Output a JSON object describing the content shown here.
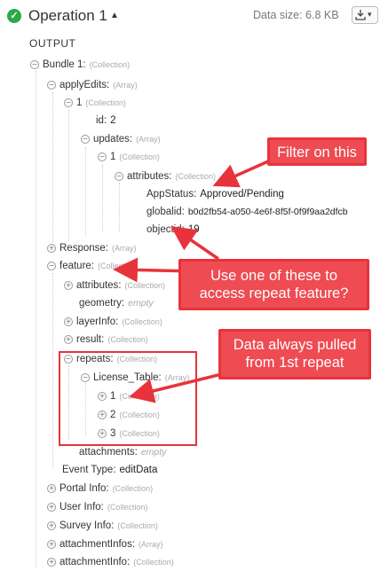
{
  "header": {
    "title": "Operation 1",
    "data_size": "Data size: 6.8 KB",
    "output_label": "OUTPUT"
  },
  "tree": {
    "bundle": {
      "key": "Bundle 1:",
      "type": "(Collection)"
    },
    "applyEdits": {
      "key": "applyEdits:",
      "type": "(Array)"
    },
    "ae_1": {
      "key": "1",
      "type": "(Collection)"
    },
    "id": {
      "key": "id:",
      "value": "2"
    },
    "updates": {
      "key": "updates:",
      "type": "(Array)"
    },
    "up_1": {
      "key": "1",
      "type": "(Collection)"
    },
    "attributes": {
      "key": "attributes:",
      "type": "(Collection)"
    },
    "appstatus": {
      "key": "AppStatus:",
      "value": "Approved/Pending"
    },
    "globalid": {
      "key": "globalid:",
      "value": "b0d2fb54-a050-4e6f-8f5f-0f9f9aa2dfcb"
    },
    "objectid": {
      "key": "objectid:",
      "value": "19"
    },
    "response": {
      "key": "Response:",
      "type": "(Array)"
    },
    "feature": {
      "key": "feature:",
      "type": "(Collection)"
    },
    "f_attributes": {
      "key": "attributes:",
      "type": "(Collection)"
    },
    "geometry": {
      "key": "geometry:",
      "value": "empty"
    },
    "layerinfo": {
      "key": "layerInfo:",
      "type": "(Collection)"
    },
    "result": {
      "key": "result:",
      "type": "(Collection)"
    },
    "repeats": {
      "key": "repeats:",
      "type": "(Collection)"
    },
    "license_table": {
      "key": "License_Table:",
      "type": "(Array)"
    },
    "lt_1": {
      "key": "1",
      "type": "(Collection)"
    },
    "lt_2": {
      "key": "2",
      "type": "(Collection)"
    },
    "lt_3": {
      "key": "3",
      "type": "(Collection)"
    },
    "attachments": {
      "key": "attachments:",
      "value": "empty"
    },
    "event_type": {
      "key": "Event Type:",
      "value": "editData"
    },
    "portal_info": {
      "key": "Portal Info:",
      "type": "(Collection)"
    },
    "user_info": {
      "key": "User Info:",
      "type": "(Collection)"
    },
    "survey_info": {
      "key": "Survey Info:",
      "type": "(Collection)"
    },
    "attachment_infos": {
      "key": "attachmentInfos:",
      "type": "(Array)"
    },
    "attachment_info": {
      "key": "attachmentInfo:",
      "type": "(Collection)"
    }
  },
  "annotations": {
    "filter": "Filter on this",
    "use_one_line1": "Use one of these to",
    "use_one_line2": "access repeat feature?",
    "data_line1": "Data always pulled",
    "data_line2": "from 1st repeat"
  },
  "colors": {
    "annotation_red": "#e8333b",
    "success_green": "#2aa84a"
  }
}
